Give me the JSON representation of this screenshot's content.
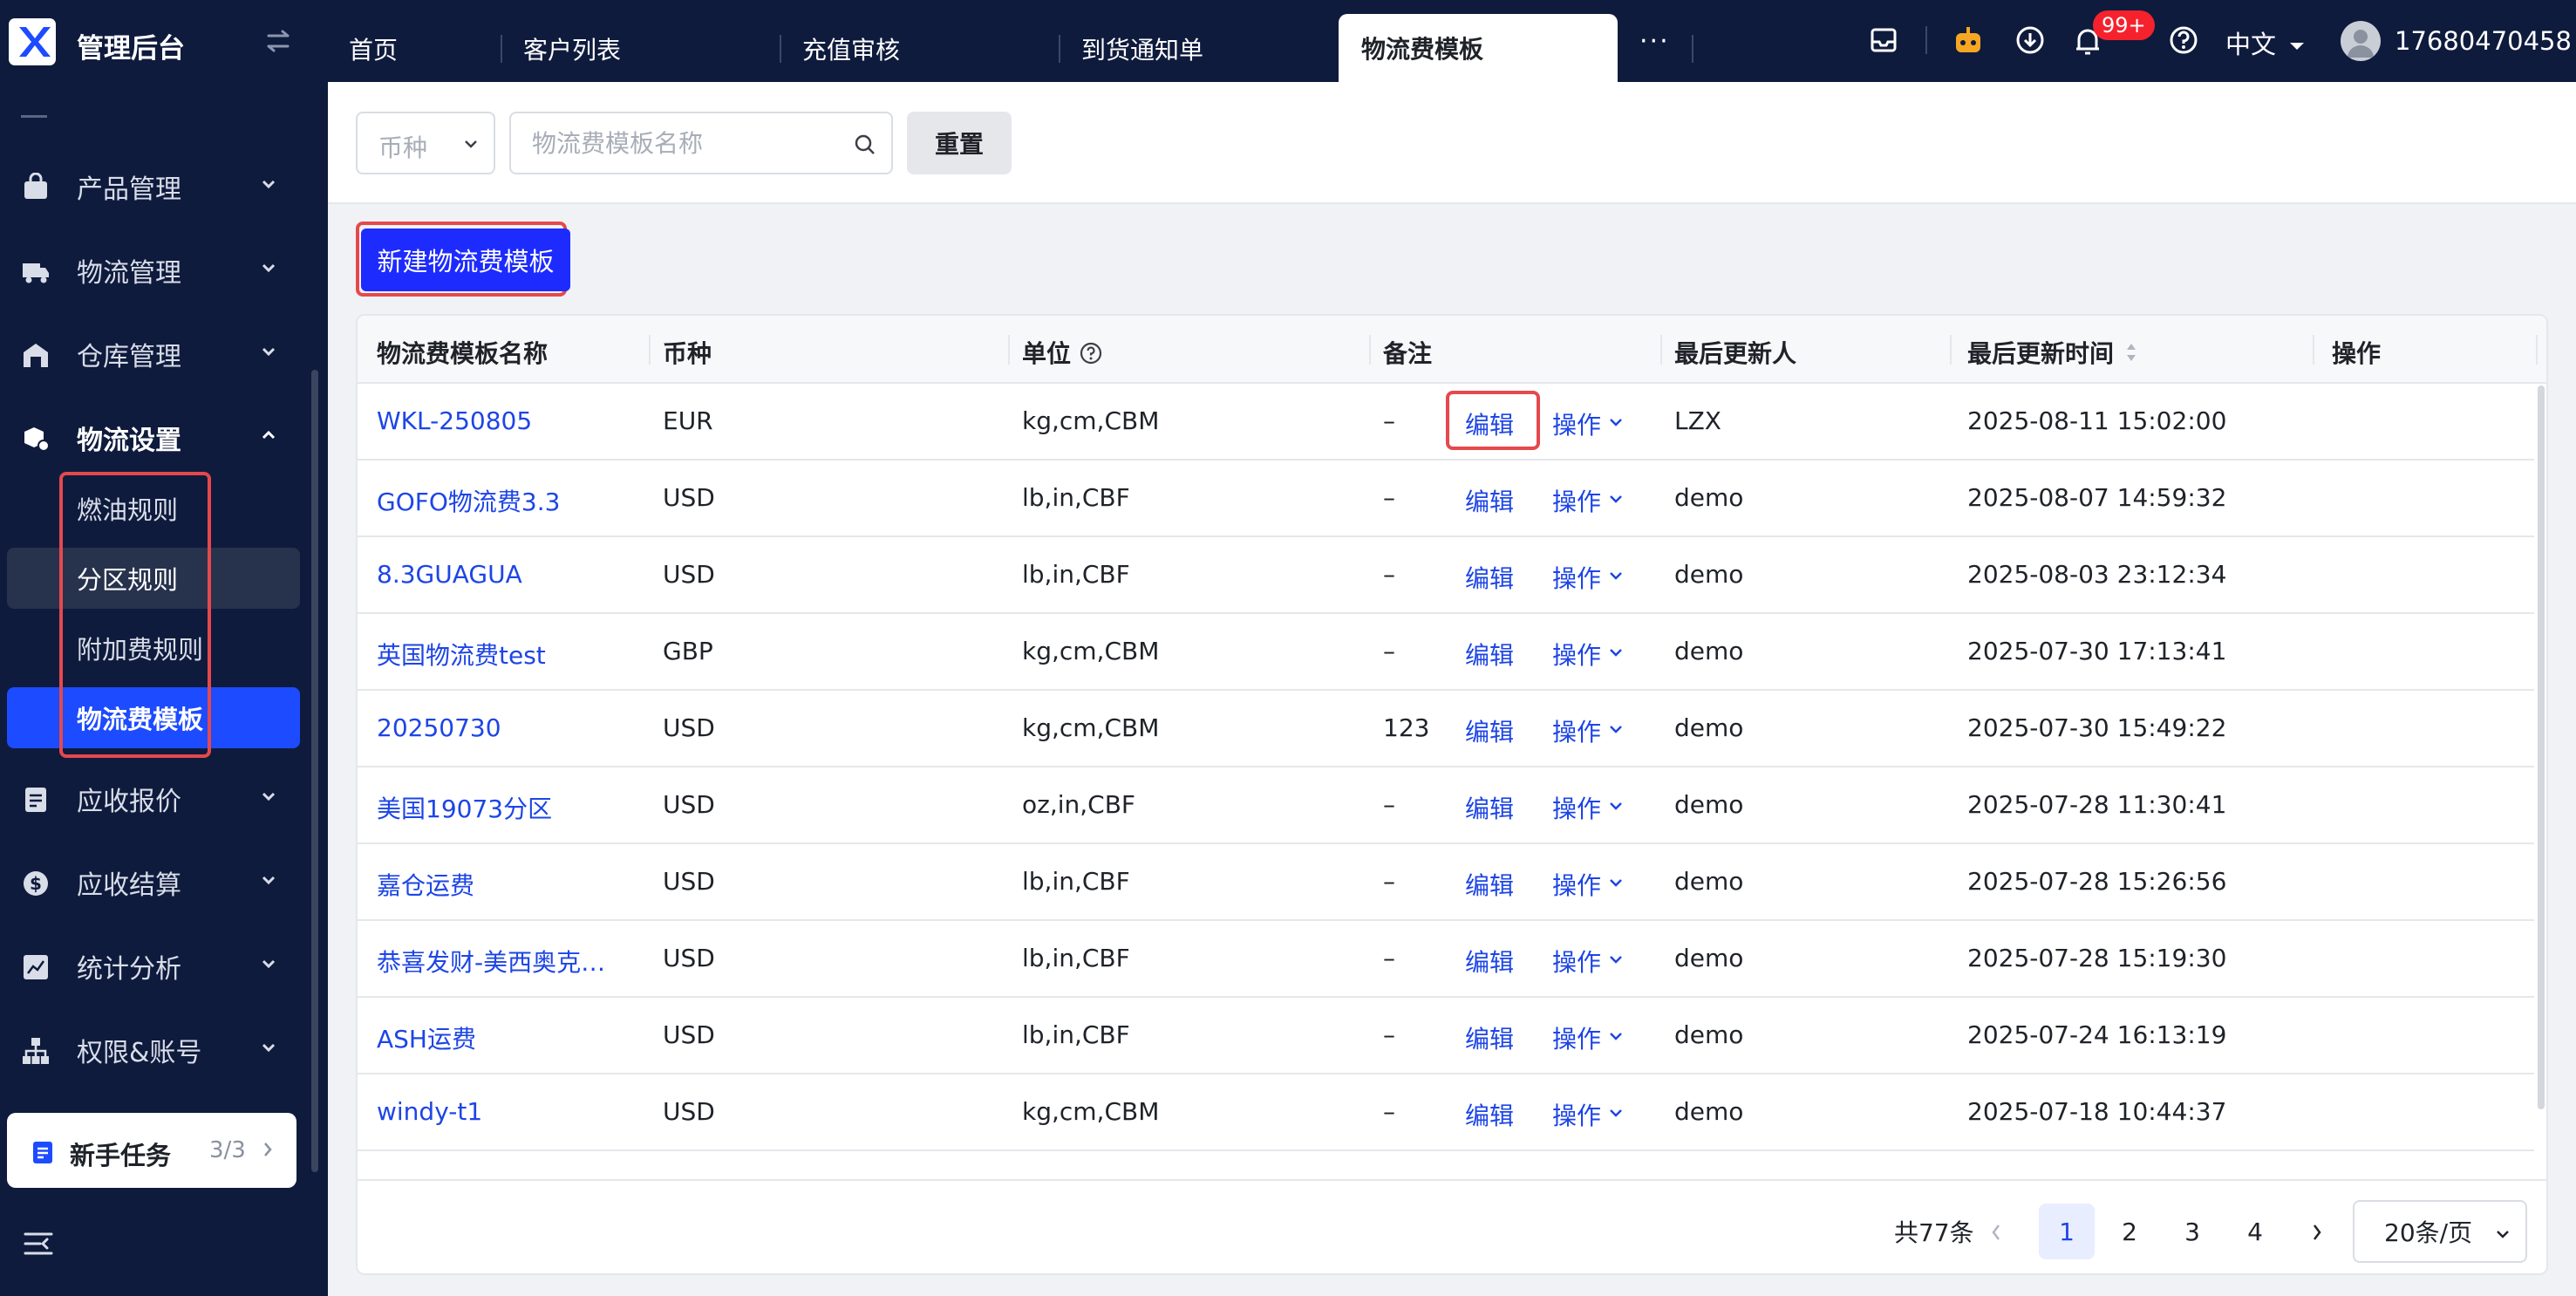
{
  "app": {
    "title": "管理后台"
  },
  "tabs": [
    {
      "label": "首页"
    },
    {
      "label": "客户列表"
    },
    {
      "label": "充值审核"
    },
    {
      "label": "到货通知单"
    },
    {
      "label": "物流费模板"
    }
  ],
  "tabs_more": "···",
  "header": {
    "notification_badge": "99+",
    "language": "中文",
    "username": "17680470458"
  },
  "sidebar": {
    "items": [
      {
        "label": "产品管理"
      },
      {
        "label": "物流管理"
      },
      {
        "label": "仓库管理"
      },
      {
        "label": "物流设置"
      },
      {
        "label": "应收报价"
      },
      {
        "label": "应收结算"
      },
      {
        "label": "统计分析"
      },
      {
        "label": "权限&账号"
      }
    ],
    "sub_items": [
      {
        "label": "燃油规则"
      },
      {
        "label": "分区规则"
      },
      {
        "label": "附加费规则"
      },
      {
        "label": "物流费模板"
      }
    ],
    "task": {
      "label": "新手任务",
      "count": "3/3"
    }
  },
  "filters": {
    "currency_placeholder": "币种",
    "search_placeholder": "物流费模板名称",
    "reset_label": "重置"
  },
  "toolbar": {
    "new_label": "新建物流费模板"
  },
  "table": {
    "columns": [
      "物流费模板名称",
      "币种",
      "单位",
      "备注",
      "最后更新人",
      "最后更新时间",
      "操作"
    ],
    "rows": [
      {
        "name": "WKL-250805",
        "currency": "EUR",
        "unit": "kg,cm,CBM",
        "remark": "–",
        "updater": "LZX",
        "time": "2025-08-11 15:02:00",
        "edit": "编辑",
        "op": "操作"
      },
      {
        "name": "GOFO物流费3.3",
        "currency": "USD",
        "unit": "lb,in,CBF",
        "remark": "–",
        "updater": "demo",
        "time": "2025-08-07 14:59:32",
        "edit": "编辑",
        "op": "操作"
      },
      {
        "name": "8.3GUAGUA",
        "currency": "USD",
        "unit": "lb,in,CBF",
        "remark": "–",
        "updater": "demo",
        "time": "2025-08-03 23:12:34",
        "edit": "编辑",
        "op": "操作"
      },
      {
        "name": "英国物流费test",
        "currency": "GBP",
        "unit": "kg,cm,CBM",
        "remark": "–",
        "updater": "demo",
        "time": "2025-07-30 17:13:41",
        "edit": "编辑",
        "op": "操作"
      },
      {
        "name": "20250730",
        "currency": "USD",
        "unit": "kg,cm,CBM",
        "remark": "123",
        "updater": "demo",
        "time": "2025-07-30 15:49:22",
        "edit": "编辑",
        "op": "操作"
      },
      {
        "name": "美国19073分区",
        "currency": "USD",
        "unit": "oz,in,CBF",
        "remark": "–",
        "updater": "demo",
        "time": "2025-07-28 11:30:41",
        "edit": "编辑",
        "op": "操作"
      },
      {
        "name": "嘉仓运费",
        "currency": "USD",
        "unit": "lb,in,CBF",
        "remark": "–",
        "updater": "demo",
        "time": "2025-07-28 15:26:56",
        "edit": "编辑",
        "op": "操作"
      },
      {
        "name": "恭喜发财-美西奥克…",
        "currency": "USD",
        "unit": "lb,in,CBF",
        "remark": "–",
        "updater": "demo",
        "time": "2025-07-28 15:19:30",
        "edit": "编辑",
        "op": "操作"
      },
      {
        "name": "ASH运费",
        "currency": "USD",
        "unit": "lb,in,CBF",
        "remark": "–",
        "updater": "demo",
        "time": "2025-07-24 16:13:19",
        "edit": "编辑",
        "op": "操作"
      },
      {
        "name": "windy-t1",
        "currency": "USD",
        "unit": "kg,cm,CBM",
        "remark": "–",
        "updater": "demo",
        "time": "2025-07-18 10:44:37",
        "edit": "编辑",
        "op": "操作"
      }
    ]
  },
  "pagination": {
    "total": "共77条",
    "pages": [
      "1",
      "2",
      "3",
      "4"
    ],
    "current": "1",
    "page_size": "20条/页"
  },
  "colors": {
    "sidebar_bg": "#0f1b3d",
    "accent": "#1d45e6",
    "primary_button": "#1d2bff",
    "highlight_border": "#e5484d"
  },
  "icons": [
    "logo-icon",
    "collapse-icon",
    "mailbox-icon",
    "robot-icon",
    "download-icon",
    "bell-icon",
    "help-icon",
    "chevron-down-icon",
    "search-icon",
    "question-icon",
    "sort-icon",
    "task-icon",
    "menu-toggle-icon"
  ]
}
